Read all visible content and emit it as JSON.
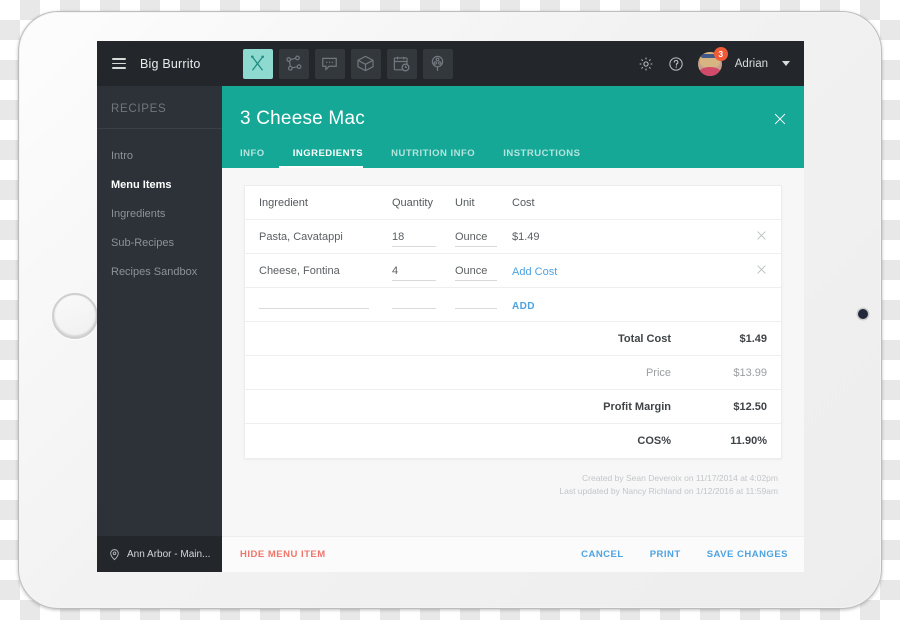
{
  "topnav": {
    "menu_icon": "hamburger-icon",
    "brand": "Big Burrito",
    "icons": [
      {
        "name": "utensils-icon",
        "active": true
      },
      {
        "name": "network-nodes-icon",
        "active": false
      },
      {
        "name": "chat-bubble-icon",
        "active": false
      },
      {
        "name": "box-package-icon",
        "active": false
      },
      {
        "name": "calendar-clock-icon",
        "active": false
      },
      {
        "name": "magnifier-people-icon",
        "active": false
      }
    ],
    "settings_icon": "gear-icon",
    "help_icon": "question-circle-icon",
    "avatar": "user-avatar",
    "badge_count": "3",
    "username": "Adrian",
    "caret": "chevron-down-icon"
  },
  "sidebar": {
    "title": "RECIPES",
    "items": [
      {
        "label": "Intro",
        "active": false
      },
      {
        "label": "Menu Items",
        "active": true
      },
      {
        "label": "Ingredients",
        "active": false
      },
      {
        "label": "Sub-Recipes",
        "active": false
      },
      {
        "label": "Recipes Sandbox",
        "active": false
      }
    ],
    "location": {
      "icon": "location-pin-icon",
      "label": "Ann Arbor - Main..."
    }
  },
  "panel": {
    "title": "3 Cheese Mac",
    "close_icon": "close-icon",
    "accent_color": "#16a897",
    "tabs": [
      {
        "label": "INFO",
        "active": false
      },
      {
        "label": "INGREDIENTS",
        "active": true
      },
      {
        "label": "NUTRITION INFO",
        "active": false
      },
      {
        "label": "INSTRUCTIONS",
        "active": false
      }
    ]
  },
  "table": {
    "headers": {
      "ingredient": "Ingredient",
      "quantity": "Quantity",
      "unit": "Unit",
      "cost": "Cost"
    },
    "rows": [
      {
        "ingredient": "Pasta, Cavatappi",
        "quantity": "18",
        "unit": "Ounce",
        "cost": "$1.49",
        "cost_is_link": false,
        "remove_icon": "close-icon"
      },
      {
        "ingredient": "Cheese, Fontina",
        "quantity": "4",
        "unit": "Ounce",
        "cost": "Add Cost",
        "cost_is_link": true,
        "remove_icon": "close-icon"
      }
    ],
    "new_row": {
      "ingredient": "",
      "quantity": "",
      "unit": "",
      "add_label": "ADD"
    },
    "summary": [
      {
        "label": "Total Cost",
        "value": "$1.49",
        "muted": false
      },
      {
        "label": "Price",
        "value": "$13.99",
        "muted": true
      },
      {
        "label": "Profit Margin",
        "value": "$12.50",
        "muted": false
      },
      {
        "label": "COS%",
        "value": "11.90%",
        "muted": false
      }
    ]
  },
  "meta": {
    "created": "Created by Sean Deveroix on 11/17/2014 at 4:02pm",
    "updated": "Last updated by Nancy Richland on 1/12/2016 at 11:59am"
  },
  "actions": {
    "hide": "HIDE MENU ITEM",
    "cancel": "CANCEL",
    "print": "PRINT",
    "save": "SAVE CHANGES",
    "danger_color": "#f0756b",
    "link_color": "#4ea3e0"
  }
}
